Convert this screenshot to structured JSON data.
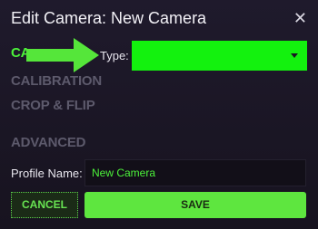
{
  "dialog": {
    "title": "Edit Camera: New Camera",
    "close_icon": "close-icon",
    "close_glyph": "✕"
  },
  "nav": {
    "items": [
      {
        "label": "CAMERA",
        "active": true,
        "visible_text": "CA"
      },
      {
        "label": "CALIBRATION",
        "active": false
      },
      {
        "label": "CROP & FLIP",
        "active": false
      },
      {
        "label": "ADVANCED",
        "active": false
      }
    ]
  },
  "annotation": {
    "icon": "arrow-right-icon",
    "color": "#55e63a"
  },
  "form": {
    "type_label": "Type:",
    "type_value": "",
    "select_color": "#13f20e",
    "profile_label": "Profile Name:",
    "profile_value": "New Camera"
  },
  "buttons": {
    "cancel_label": "CANCEL",
    "save_label": "SAVE"
  },
  "colors": {
    "accent": "#4cf23a",
    "background": "#1a1624",
    "nav_inactive": "#5d5a6c"
  }
}
